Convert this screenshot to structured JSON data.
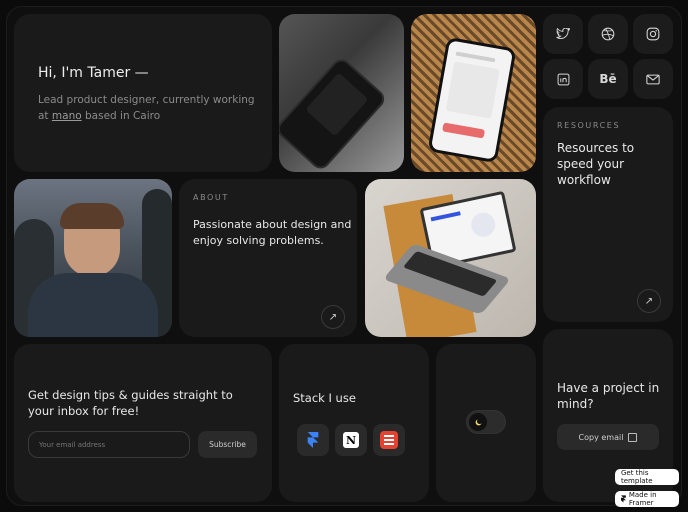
{
  "intro": {
    "title": "Hi, I'm Tamer —",
    "desc_prefix": "Lead product designer, currently working at",
    "company_link": "mano",
    "desc_suffix": "based in Cairo"
  },
  "resources": {
    "eyebrow": "RESOURCES",
    "title": "Resources to speed your workflow",
    "arrow_icon": "arrow-up-right-icon"
  },
  "about": {
    "eyebrow": "ABOUT",
    "title": "Passionate about design and enjoy solving problems.",
    "arrow_icon": "arrow-up-right-icon"
  },
  "newsletter": {
    "title": "Get design tips & guides straight to your inbox for free!",
    "email_placeholder": "Your email address",
    "subscribe_label": "Subscribe"
  },
  "stack": {
    "title": "Stack I use",
    "tools": [
      "framer-icon",
      "notion-icon",
      "todoist-icon"
    ]
  },
  "theme_toggle": {
    "icon": "moon-icon"
  },
  "contact": {
    "title": "Have a project in mind?",
    "copy_email_label": "Copy email",
    "copy_icon": "copy-icon"
  },
  "social": [
    "twitter-icon",
    "dribbble-icon",
    "instagram-icon",
    "linkedin-icon",
    "behance-icon",
    "mail-icon"
  ],
  "template_badges": {
    "get_template": "Get this template",
    "made_in_framer": "Made in Framer"
  },
  "colors": {
    "background": "#0b0b0b",
    "card": "#1a1a1a",
    "text_primary": "#e6e6e6",
    "text_secondary": "#8a8a8a",
    "todoist_red": "#e44332"
  }
}
